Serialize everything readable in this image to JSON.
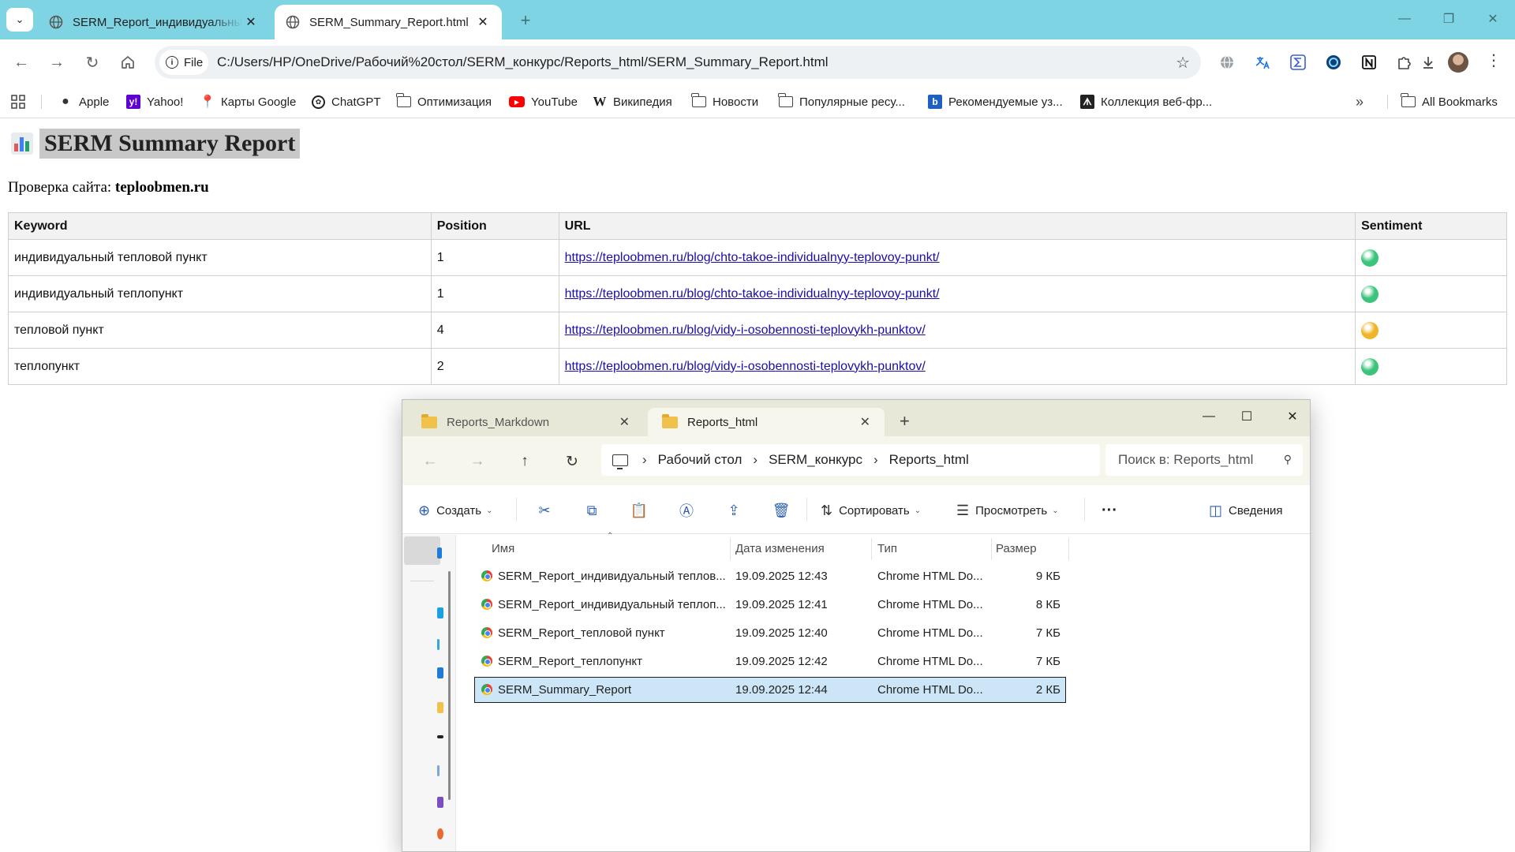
{
  "browser": {
    "tabs": [
      {
        "title": "SERM_Report_индивидуальный тепловой пункт",
        "active": false
      },
      {
        "title": "SERM_Summary_Report.html",
        "active": true
      }
    ],
    "omnibox": {
      "chip_label": "File",
      "url": "C:/Users/HP/OneDrive/Рабочий%20стол/SERM_конкурс/Reports_html/SERM_Summary_Report.html"
    },
    "bookmarks": [
      {
        "label": "Apple",
        "icon": "apple-icon"
      },
      {
        "label": "Yahoo!",
        "icon": "yahoo-icon"
      },
      {
        "label": "Карты Google",
        "icon": "maps-pin-icon"
      },
      {
        "label": "ChatGPT",
        "icon": "chatgpt-icon"
      },
      {
        "label": "Оптимизация",
        "icon": "folder-icon"
      },
      {
        "label": "YouTube",
        "icon": "youtube-icon"
      },
      {
        "label": "Википедия",
        "icon": "wikipedia-icon"
      },
      {
        "label": "Новости",
        "icon": "folder-icon"
      },
      {
        "label": "Популярные ресу...",
        "icon": "folder-icon"
      },
      {
        "label": "Рекомендуемые уз...",
        "icon": "bing-icon"
      },
      {
        "label": "Коллекция веб-фр...",
        "icon": "web-slice-icon"
      }
    ],
    "all_bookmarks": "All Bookmarks",
    "accent": "#7fd4e3"
  },
  "report": {
    "title": "SERM Summary Report",
    "site_label": "Проверка сайта:",
    "site": "teploobmen.ru",
    "columns": [
      "Keyword",
      "Position",
      "URL",
      "Sentiment"
    ],
    "rows": [
      {
        "keyword": "индивидуальный тепловой пункт",
        "position": "1",
        "url": "https://teploobmen.ru/blog/chto-takoe-individualnyy-teplovoy-punkt/",
        "sentiment": "positive",
        "color": "#3cc47c"
      },
      {
        "keyword": "индивидуальный теплопункт",
        "position": "1",
        "url": "https://teploobmen.ru/blog/chto-takoe-individualnyy-teplovoy-punkt/",
        "sentiment": "positive",
        "color": "#3cc47c"
      },
      {
        "keyword": "тепловой пункт",
        "position": "4",
        "url": "https://teploobmen.ru/blog/vidy-i-osobennosti-teplovykh-punktov/",
        "sentiment": "neutral",
        "color": "#f0b429"
      },
      {
        "keyword": "теплопункт",
        "position": "2",
        "url": "https://teploobmen.ru/blog/vidy-i-osobennosti-teplovykh-punktov/",
        "sentiment": "positive",
        "color": "#3cc47c"
      }
    ]
  },
  "explorer": {
    "tabs": [
      "Reports_Markdown",
      "Reports_html"
    ],
    "breadcrumb": [
      "Рабочий стол",
      "SERM_конкурс",
      "Reports_html"
    ],
    "search_placeholder": "Поиск в: Reports_html",
    "commands": {
      "create": "Создать",
      "sort": "Сортировать",
      "view": "Просмотреть",
      "details": "Сведения"
    },
    "columns": [
      "Имя",
      "Дата изменения",
      "Тип",
      "Размер"
    ],
    "files": [
      {
        "name": "SERM_Report_индивидуальный теплов...",
        "date": "19.09.2025 12:43",
        "type": "Chrome HTML Do...",
        "size": "9 КБ",
        "selected": false
      },
      {
        "name": "SERM_Report_индивидуальный теплоп...",
        "date": "19.09.2025 12:41",
        "type": "Chrome HTML Do...",
        "size": "8 КБ",
        "selected": false
      },
      {
        "name": "SERM_Report_тепловой пункт",
        "date": "19.09.2025 12:40",
        "type": "Chrome HTML Do...",
        "size": "7 КБ",
        "selected": false
      },
      {
        "name": "SERM_Report_теплопункт",
        "date": "19.09.2025 12:42",
        "type": "Chrome HTML Do...",
        "size": "7 КБ",
        "selected": false
      },
      {
        "name": "SERM_Summary_Report",
        "date": "19.09.2025 12:44",
        "type": "Chrome HTML Do...",
        "size": "2 КБ",
        "selected": true
      }
    ]
  }
}
